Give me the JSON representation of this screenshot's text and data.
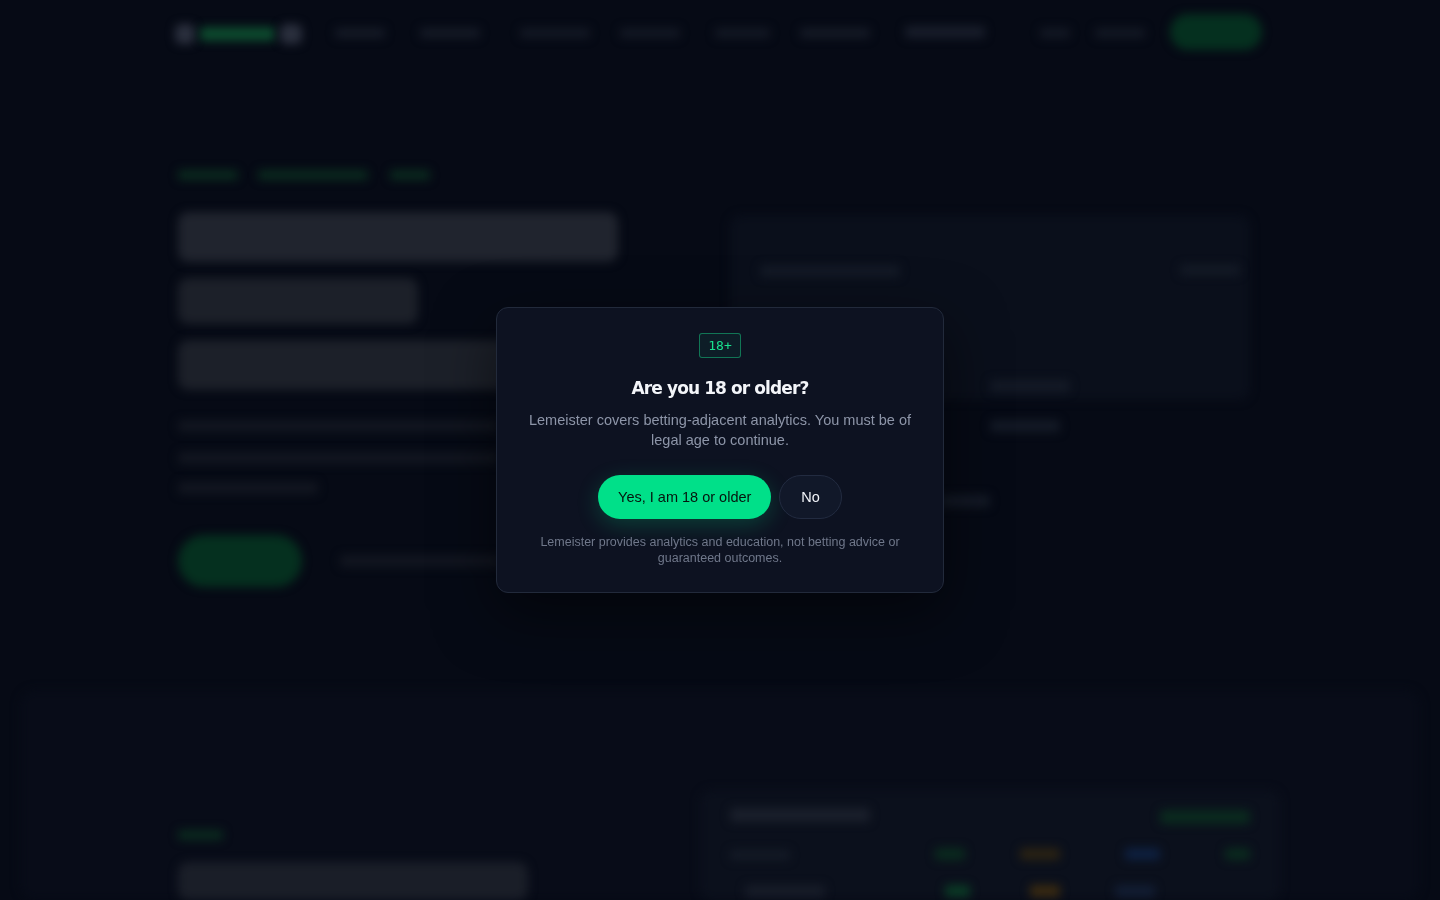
{
  "age_gate": {
    "badge": "18+",
    "title": "Are you 18 or older?",
    "message": "Lemeister covers betting-adjacent analytics. You must be of legal age to continue.",
    "buttons": [
      {
        "label": "Yes, I am 18 or older",
        "kind": "primary"
      },
      {
        "label": "No",
        "kind": "secondary"
      }
    ],
    "disclaimer": "Lemeister provides analytics and education, not betting advice or guaranteed outcomes."
  }
}
